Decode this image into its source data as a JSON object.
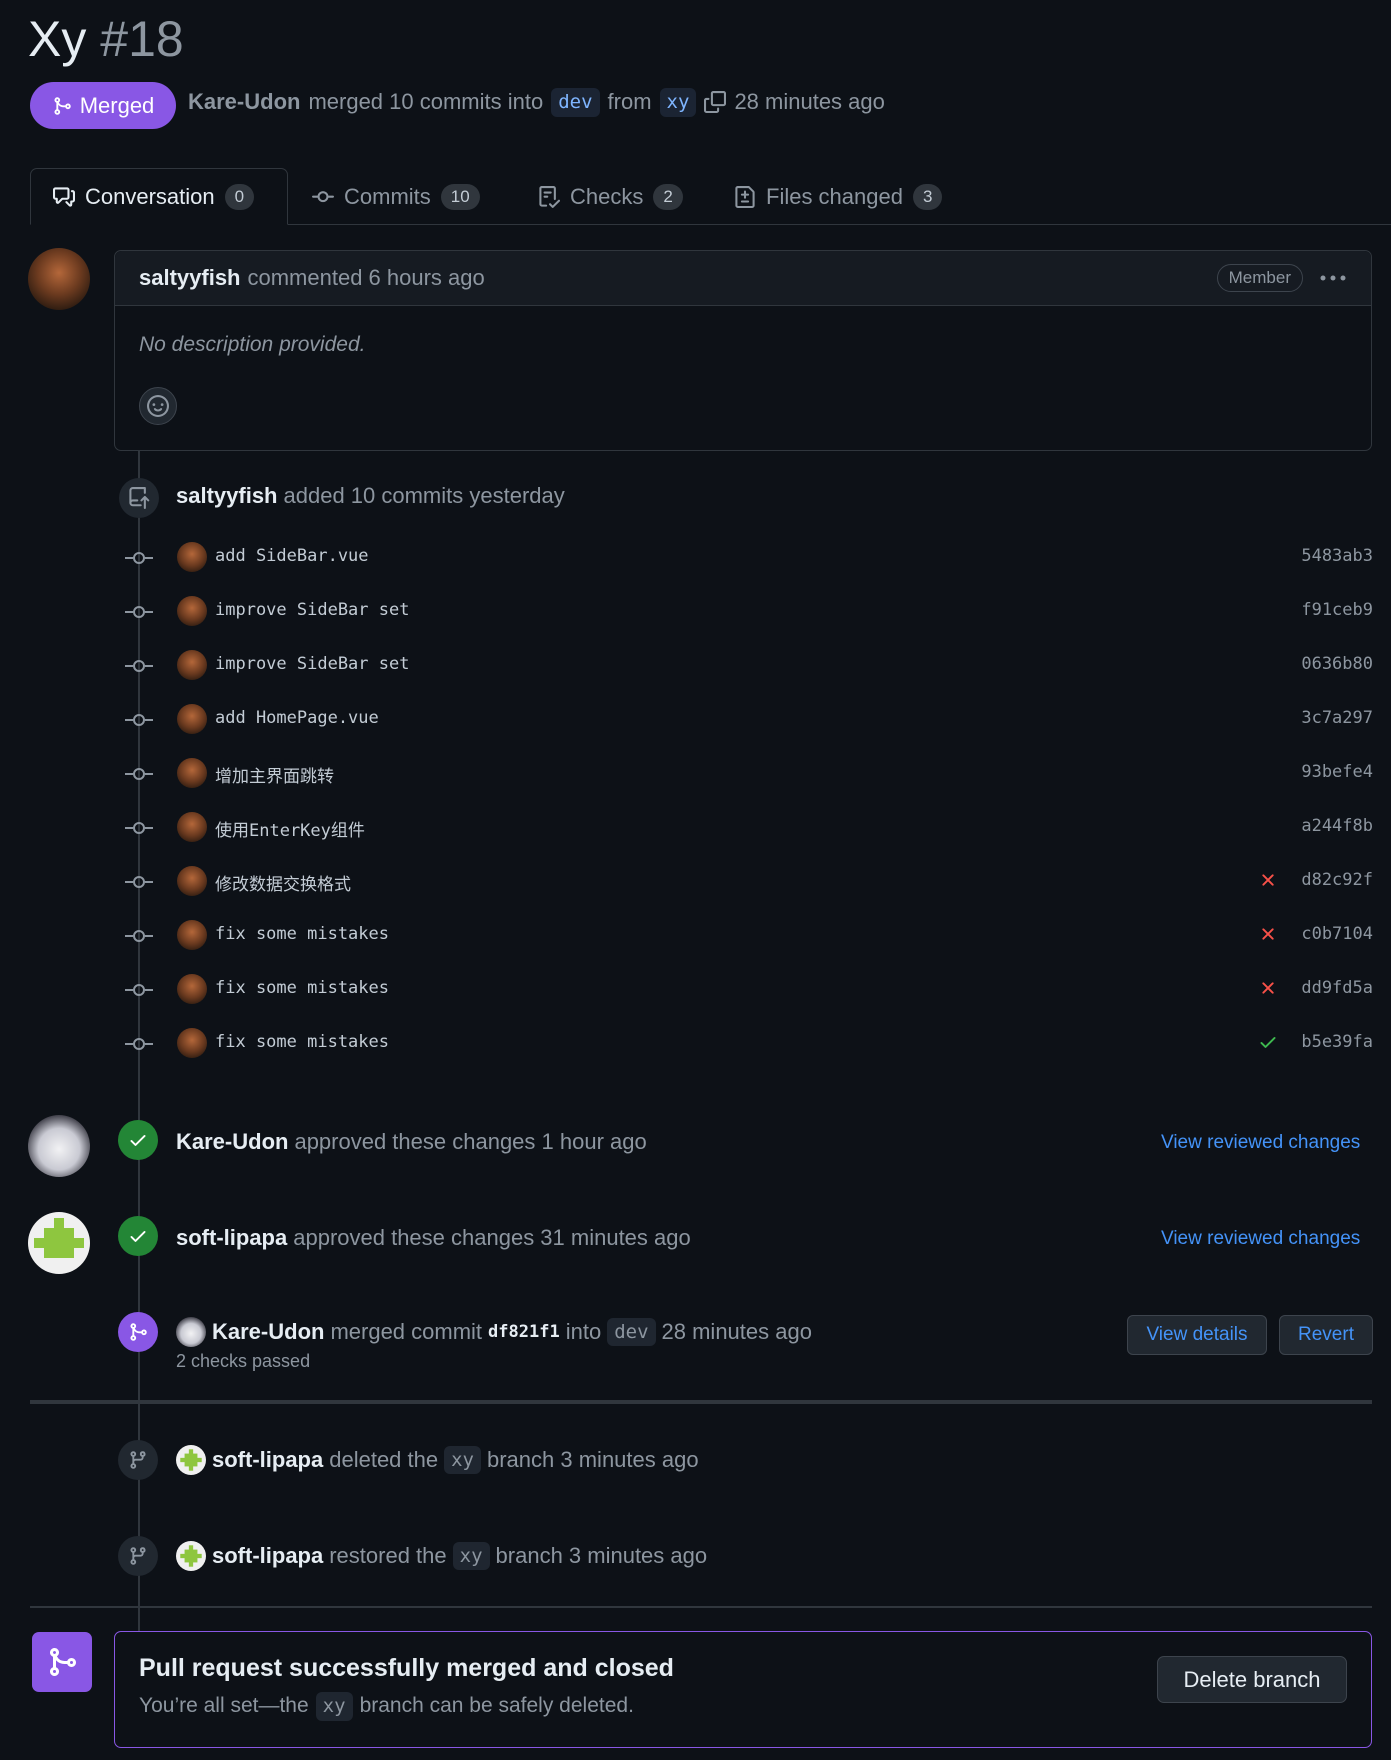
{
  "pr": {
    "title": "Xy",
    "number": "#18",
    "state_label": "Merged",
    "author": "Kare-Udon",
    "action_text": "merged 10 commits into",
    "base_branch": "dev",
    "from_text": "from",
    "head_branch": "xy",
    "time": "28 minutes ago"
  },
  "tabs": [
    {
      "label": "Conversation",
      "count": "0"
    },
    {
      "label": "Commits",
      "count": "10"
    },
    {
      "label": "Checks",
      "count": "2"
    },
    {
      "label": "Files changed",
      "count": "3"
    }
  ],
  "comment": {
    "author": "saltyyfish",
    "meta": "commented 6 hours ago",
    "badge": "Member",
    "body": "No description provided."
  },
  "commits_event": {
    "author": "saltyyfish",
    "text": "added 10 commits yesterday"
  },
  "commits": [
    {
      "message": "add SideBar.vue",
      "sha": "5483ab3",
      "status": ""
    },
    {
      "message": "improve SideBar set",
      "sha": "f91ceb9",
      "status": ""
    },
    {
      "message": "improve SideBar set",
      "sha": "0636b80",
      "status": ""
    },
    {
      "message": "add HomePage.vue",
      "sha": "3c7a297",
      "status": ""
    },
    {
      "message": "增加主界面跳转",
      "sha": "93befe4",
      "status": ""
    },
    {
      "message": "使用EnterKey组件",
      "sha": "a244f8b",
      "status": ""
    },
    {
      "message": "修改数据交换格式",
      "sha": "d82c92f",
      "status": "fail"
    },
    {
      "message": "fix some mistakes",
      "sha": "c0b7104",
      "status": "fail"
    },
    {
      "message": "fix some mistakes",
      "sha": "dd9fd5a",
      "status": "fail"
    },
    {
      "message": "fix some mistakes",
      "sha": "b5e39fa",
      "status": "success"
    }
  ],
  "reviews": [
    {
      "author": "Kare-Udon",
      "text": "approved these changes 1 hour ago",
      "link": "View reviewed changes"
    },
    {
      "author": "soft-lipapa",
      "text": "approved these changes 31 minutes ago",
      "link": "View reviewed changes"
    }
  ],
  "merge_event": {
    "author": "Kare-Udon",
    "text": "merged commit",
    "sha": "df821f1",
    "into": "into",
    "branch": "dev",
    "time": "28 minutes ago",
    "checks": "2 checks passed",
    "details_button": "View details",
    "revert_button": "Revert"
  },
  "branch_events": [
    {
      "author": "soft-lipapa",
      "action": "deleted the",
      "branch": "xy",
      "tail": "branch 3 minutes ago"
    },
    {
      "author": "soft-lipapa",
      "action": "restored the",
      "branch": "xy",
      "tail": "branch 3 minutes ago"
    }
  ],
  "final": {
    "title": "Pull request successfully merged and closed",
    "pre": "You’re all set—the",
    "branch": "xy",
    "post": "branch can be safely deleted.",
    "button": "Delete branch"
  },
  "colors": {
    "background": "#0d1117",
    "merged": "#8957e5",
    "success": "#238636",
    "fail": "#f85149",
    "link": "#4493f8"
  }
}
